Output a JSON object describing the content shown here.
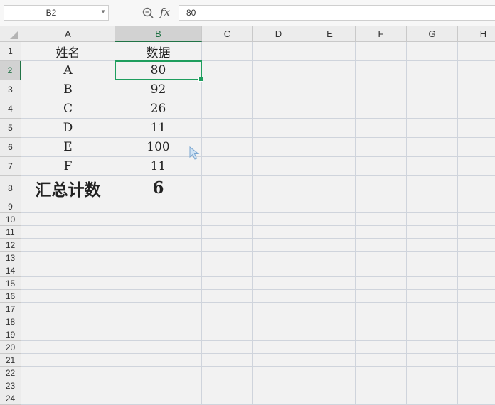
{
  "name_box": {
    "value": "B2"
  },
  "formula_bar": {
    "value": "80",
    "fx_label": "fx"
  },
  "colors": {
    "selection": "#217346",
    "active_border": "#1e9e5e"
  },
  "columns": [
    "A",
    "B",
    "C",
    "D",
    "E",
    "F",
    "G",
    "H"
  ],
  "rows": [
    "1",
    "2",
    "3",
    "4",
    "5",
    "6",
    "7",
    "8",
    "9",
    "10",
    "11",
    "12",
    "13",
    "14",
    "15",
    "16",
    "17",
    "18",
    "19",
    "20",
    "21",
    "22",
    "23",
    "24"
  ],
  "selected_cell": "B2",
  "cells": {
    "A1": "姓名",
    "B1": "数据",
    "A2": "A",
    "B2": "80",
    "A3": "B",
    "B3": "92",
    "A4": "C",
    "B4": "26",
    "A5": "D",
    "B5": "11",
    "A6": "E",
    "B6": "100",
    "A7": "F",
    "B7": "11",
    "A8": "汇总计数",
    "B8": "6"
  }
}
